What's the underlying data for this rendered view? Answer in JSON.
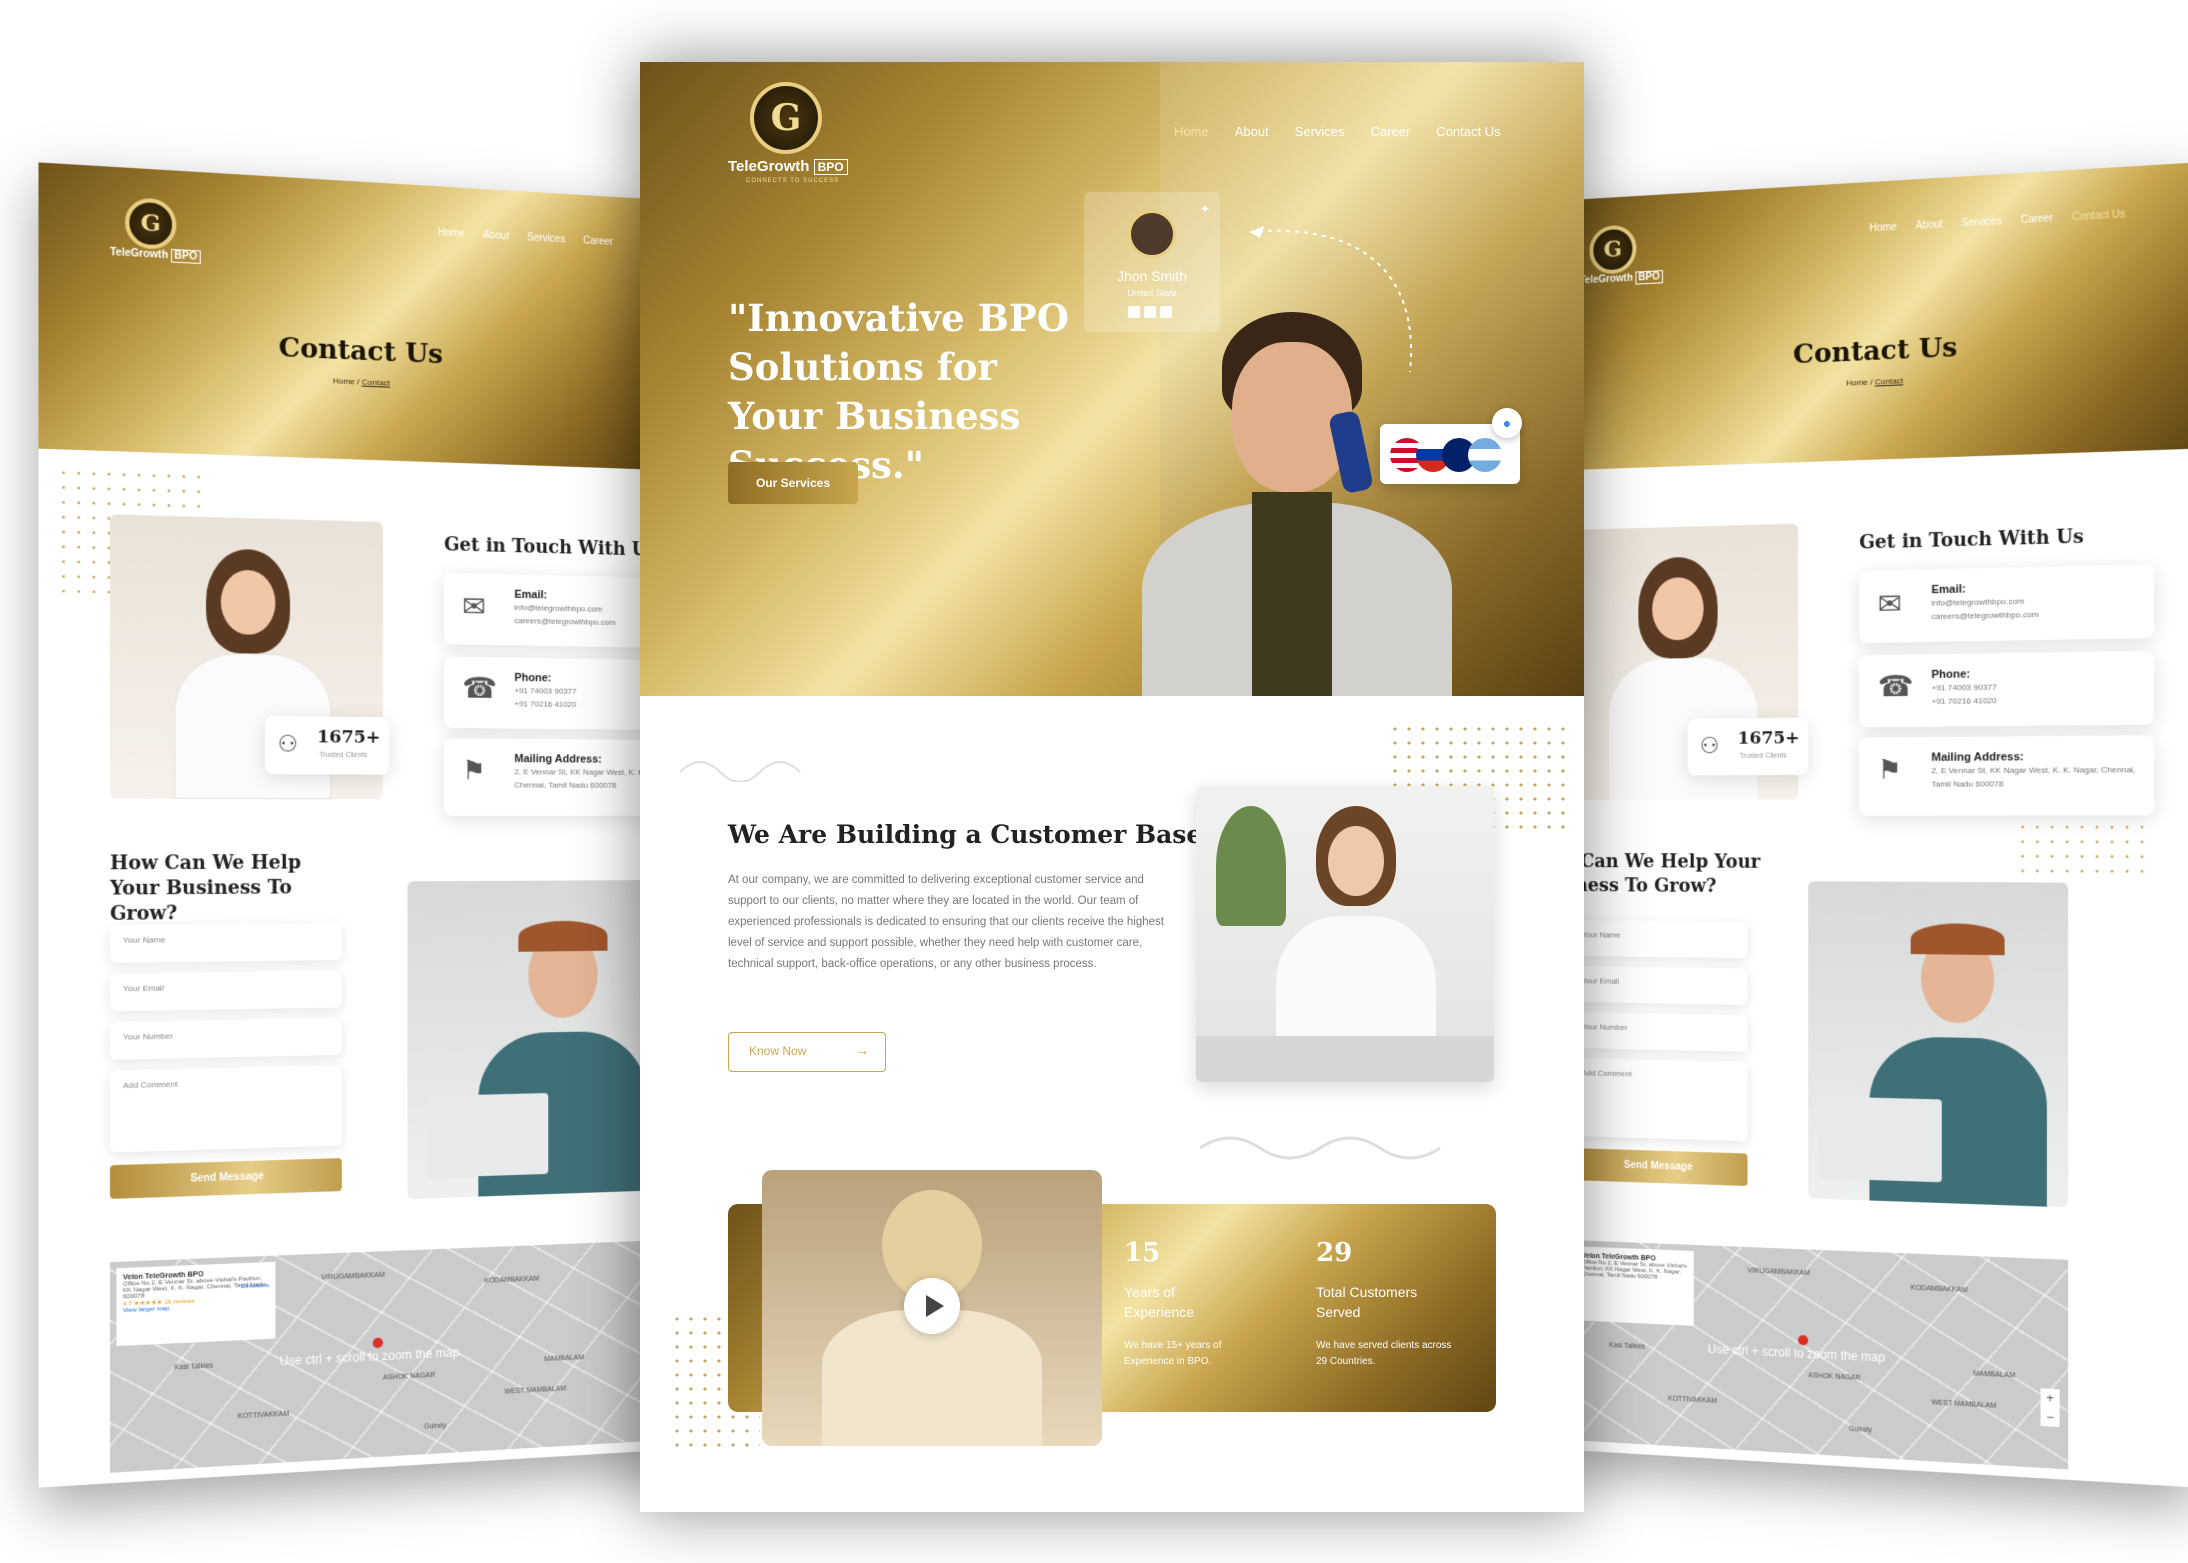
{
  "brand": {
    "name": "TeleGrowth",
    "suffix": "BPO",
    "tagline": "CONNECTS TO SUCCESS",
    "initials": "TG"
  },
  "nav": {
    "home": "Home",
    "about": "About",
    "services": "Services",
    "career": "Career",
    "contact": "Contact Us"
  },
  "contact_page": {
    "title": "Contact Us",
    "breadcrumb_home": "Home",
    "breadcrumb_sep": "/",
    "breadcrumb_current": "Contact",
    "get_in_touch": "Get in Touch With Us",
    "email_label": "Email:",
    "email_1": "info@telegrowthbpo.com",
    "email_2": "careers@telegrowthbpo.com",
    "phone_label": "Phone:",
    "phone_1": "+91 74003 90377",
    "phone_2": "+91 70216 41020",
    "address_label": "Mailing Address:",
    "address": "2, E Vennar St, KK Nagar West, K. K. Nagar, Chennai, Tamil Nadu 600078",
    "stat_value": "1675+",
    "stat_label": "Trusted Clients",
    "help_title": "How Can We Help Your Business To Grow?",
    "form_name": "Your Name",
    "form_email": "Your Email",
    "form_number": "Your Number",
    "form_comment": "Add Comment",
    "send_button": "Send Message",
    "map_title": "Velon TeleGrowth BPO",
    "map_address": "Office No 2, E Vennar St, above Vishal's Pavilion, KK Nagar West, K. K. Nagar, Chennai, Tamil Nadu 600078",
    "map_rating": "4.7 ★★★★★ 16 reviews",
    "map_larger": "View larger map",
    "map_directions": "Directions",
    "map_overlay": "Use ctrl + scroll to zoom the map",
    "map_places": [
      "VIRUGAMBAKKAM",
      "KODAMBAKKAM",
      "MAMBALAM",
      "WEST MAMBALAM",
      "ASHOK NAGAR",
      "KOTTIVAKKAM",
      "Kasi Talkies",
      "Guindy"
    ]
  },
  "home_page": {
    "hero_title": "\"Innovative BPO Solutions for Your Business Success.\"",
    "hero_button": "Our Services",
    "profile_name": "Jhon Smith",
    "profile_country": "United State",
    "about_title": "We Are Building a Customer Base!",
    "about_text": "At our company, we are committed to delivering exceptional customer service and support to our clients, no matter where they are located in the world. Our team of experienced professionals is dedicated to ensuring that our clients receive the highest level of service and support possible, whether they need help with customer care, technical support, back-office operations, or any other business process.",
    "know_button": "Know Now",
    "stat1_value": "15",
    "stat1_label": "Years of Experience",
    "stat1_desc": "We have 15+ years of Experience in BPO.",
    "stat2_value": "29",
    "stat2_label": "Total Customers Served",
    "stat2_desc": "We have served clients across 29 Countries."
  },
  "colors": {
    "gold": "#c9a64f",
    "gold_light": "#f3e3a3",
    "gold_dark": "#6e5218",
    "text_dark": "#222222"
  }
}
